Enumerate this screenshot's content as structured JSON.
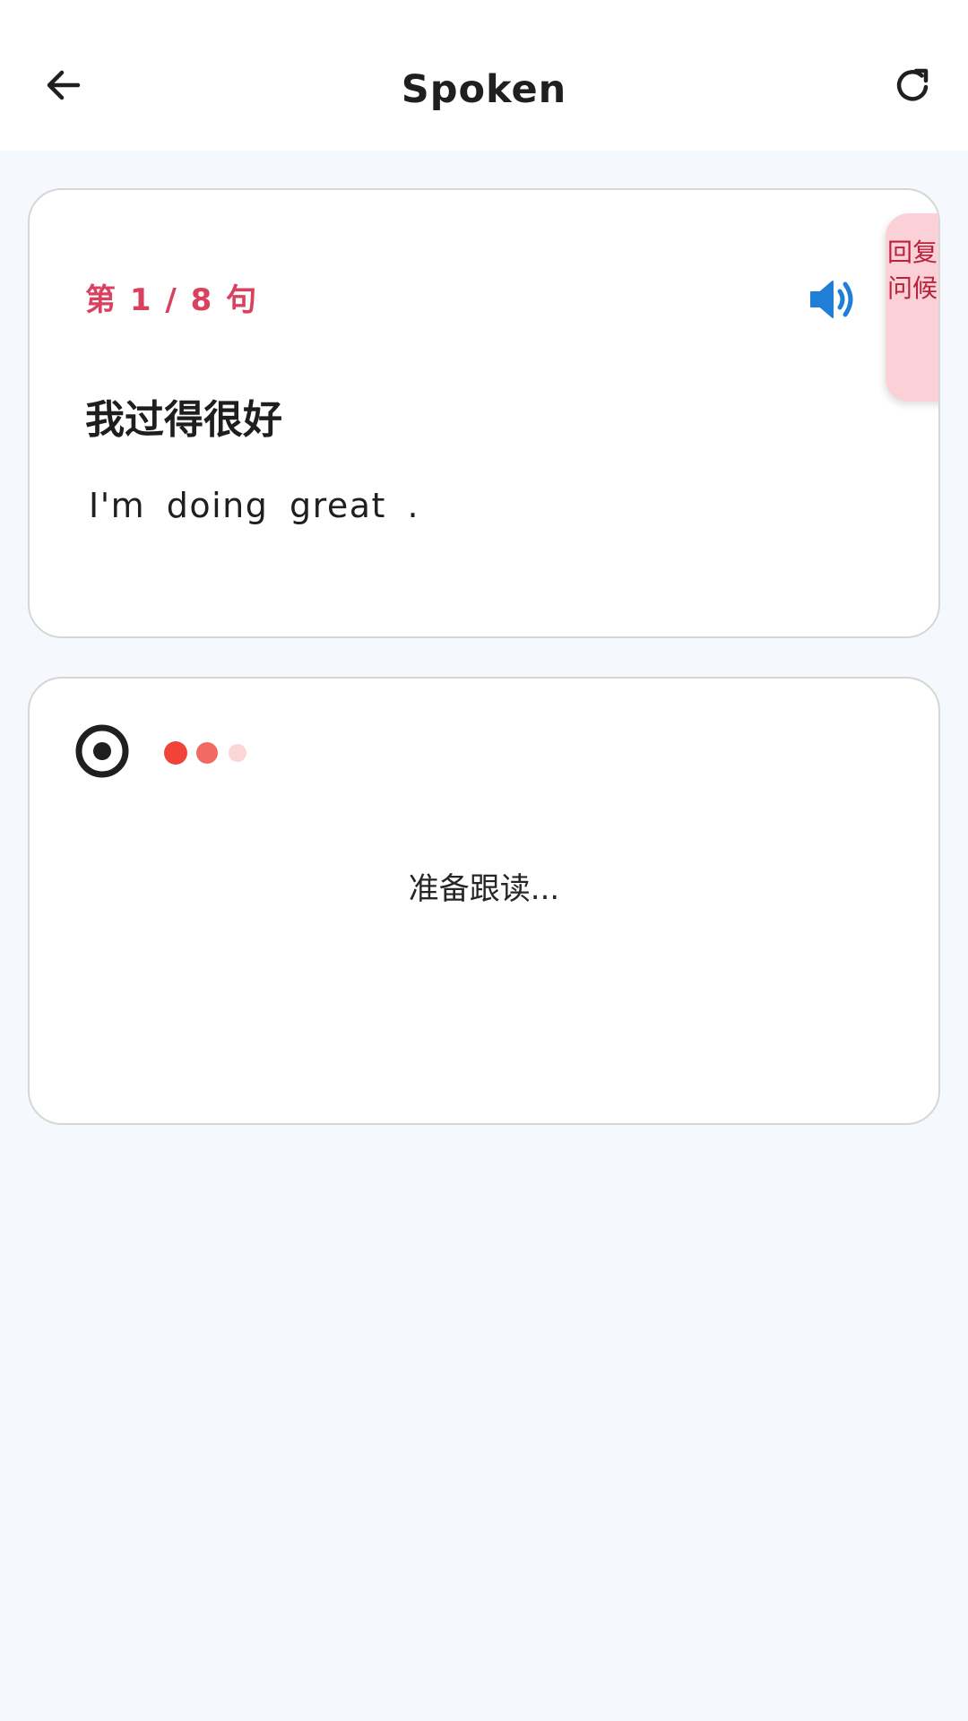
{
  "header": {
    "title": "Spoken",
    "back_icon": "arrow-left-icon",
    "refresh_icon": "refresh-icon"
  },
  "sentence_card": {
    "counter": "第 1 / 8 句",
    "speaker_icon": "speaker-volume-icon",
    "category_tag": "回复问候",
    "chinese": "我过得很好",
    "english": "I'm doing great ."
  },
  "recorder_card": {
    "record_icon": "record-target-icon",
    "status": "准备跟读..."
  },
  "colors": {
    "accent_red": "#d9415e",
    "speaker_blue": "#1f7fd6",
    "tag_bg": "#fbd0d7",
    "page_bg": "#f5f8fd"
  }
}
